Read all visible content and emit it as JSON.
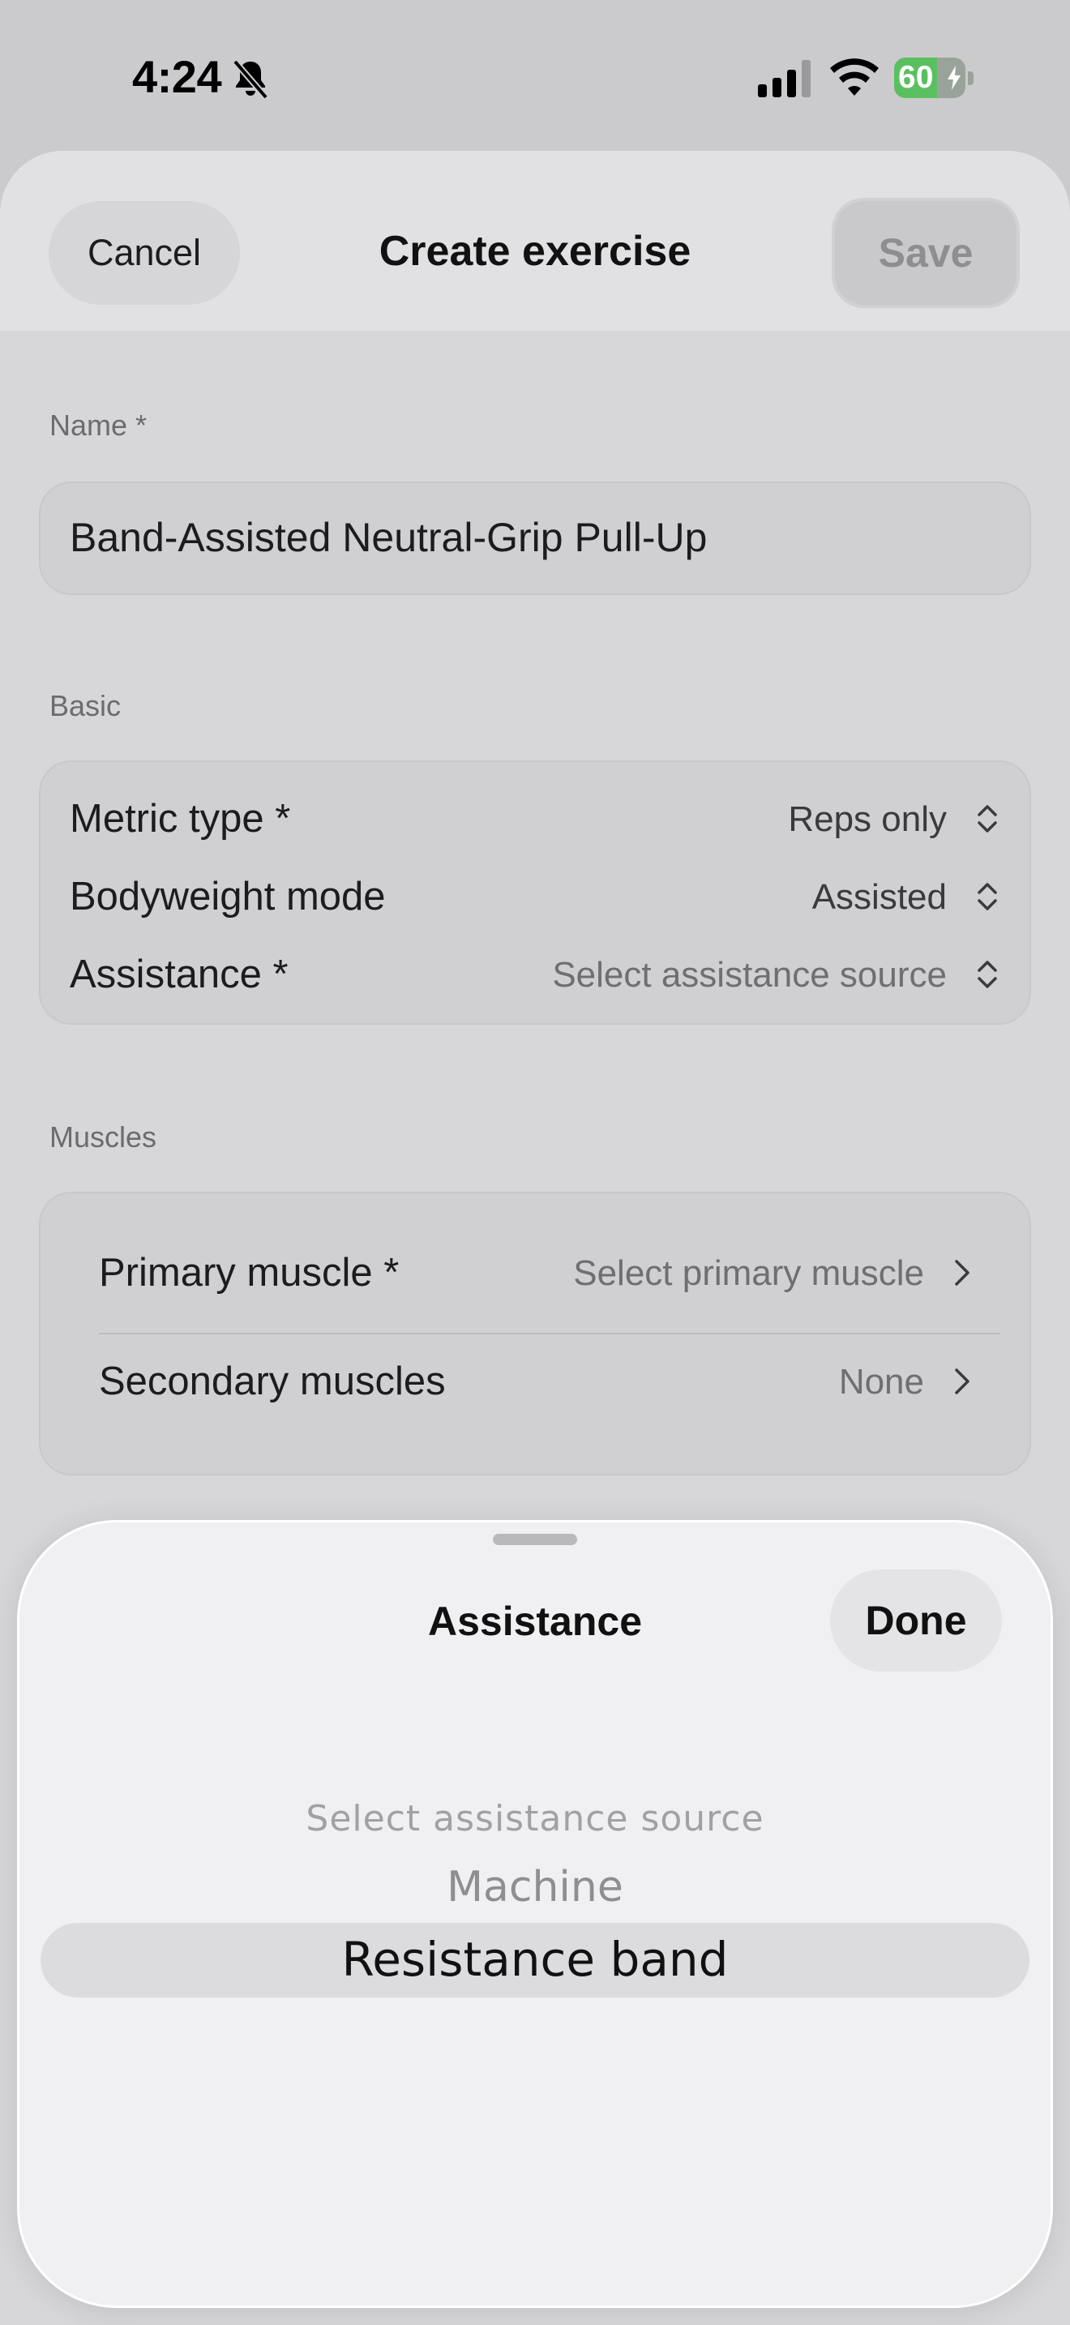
{
  "status_bar": {
    "time": "4:24",
    "battery_percent": "60",
    "battery_level": 0.6,
    "icons": [
      "bell-slash-icon",
      "cellular-signal-icon",
      "wifi-icon",
      "battery-charging-icon"
    ]
  },
  "header": {
    "cancel_label": "Cancel",
    "title": "Create exercise",
    "save_label": "Save"
  },
  "name_section": {
    "label": "Name *",
    "value": "Band-Assisted Neutral-Grip Pull-Up"
  },
  "basic_section": {
    "label": "Basic",
    "rows": [
      {
        "label": "Metric type *",
        "value": "Reps only"
      },
      {
        "label": "Bodyweight mode",
        "value": "Assisted"
      },
      {
        "label": "Assistance *",
        "value": "Select assistance source"
      }
    ]
  },
  "muscles_section": {
    "label": "Muscles",
    "rows": [
      {
        "label": "Primary muscle *",
        "value": "Select primary muscle"
      },
      {
        "label": "Secondary muscles",
        "value": "None"
      }
    ]
  },
  "picker": {
    "title": "Assistance",
    "done_label": "Done",
    "options": [
      "Select assistance source",
      "Machine",
      "Resistance band"
    ],
    "selected": "Resistance band"
  },
  "colors": {
    "battery_green": "#5ac05f",
    "dim_background": "#cbcbcd",
    "picker_background": "#f0f0f2"
  }
}
